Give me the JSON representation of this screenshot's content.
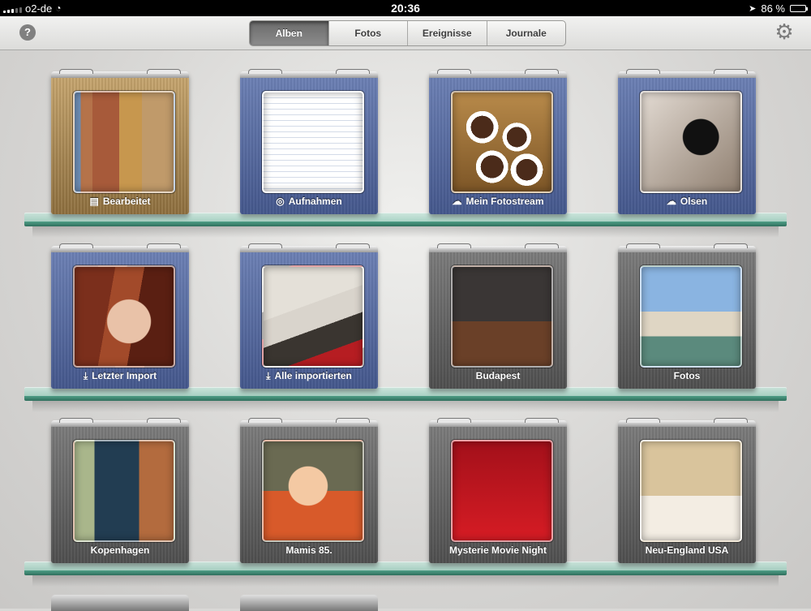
{
  "statusbar": {
    "carrier": "o2-de",
    "time": "20:36",
    "battery": "86 %",
    "battery_level": 0.86
  },
  "toolbar": {
    "help_symbol": "?",
    "tabs": [
      {
        "label": "Alben",
        "active": true
      },
      {
        "label": "Fotos",
        "active": false
      },
      {
        "label": "Ereignisse",
        "active": false
      },
      {
        "label": "Journale",
        "active": false
      }
    ]
  },
  "albums": [
    {
      "label": "Bearbeitet",
      "icon": "briefcase-icon",
      "cover": "gold"
    },
    {
      "label": "Aufnahmen",
      "icon": "camera-roll-icon",
      "cover": "blue"
    },
    {
      "label": "Mein Fotostream",
      "icon": "cloud-icon",
      "cover": "blue"
    },
    {
      "label": "Olsen",
      "icon": "cloud-icon",
      "cover": "blue"
    },
    {
      "label": "Letzter Import",
      "icon": "import-icon",
      "cover": "blue"
    },
    {
      "label": "Alle importierten",
      "icon": "import-icon",
      "cover": "blue"
    },
    {
      "label": "Budapest",
      "icon": "",
      "cover": "gray"
    },
    {
      "label": "Fotos",
      "icon": "",
      "cover": "gray"
    },
    {
      "label": "Kopenhagen",
      "icon": "",
      "cover": "gray"
    },
    {
      "label": "Mamis 85.",
      "icon": "",
      "cover": "gray"
    },
    {
      "label": "Mysterie Movie Night",
      "icon": "",
      "cover": "gray"
    },
    {
      "label": "Neu-England USA",
      "icon": "",
      "cover": "gray"
    }
  ]
}
